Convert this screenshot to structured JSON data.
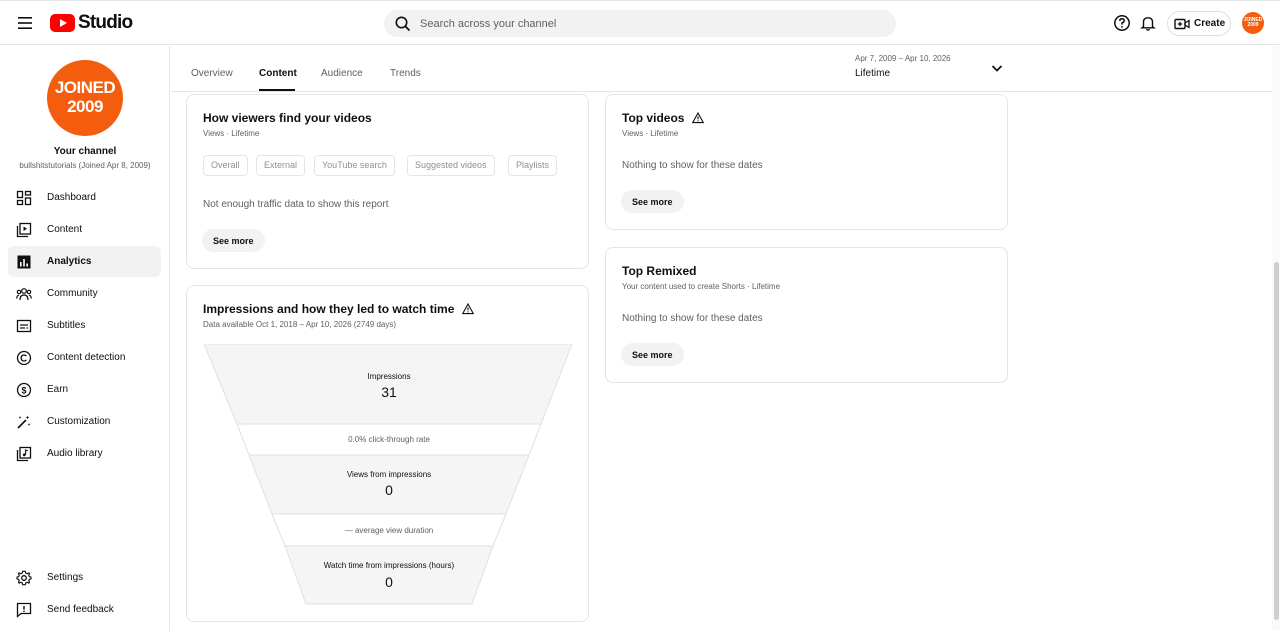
{
  "header": {
    "logo_text": "Studio",
    "search_placeholder": "Search across your channel",
    "create_label": "Create",
    "avatar_text": "JOINED 2009"
  },
  "sidebar": {
    "avatar_line1": "JOINED",
    "avatar_line2": "2009",
    "channel_title": "Your channel",
    "channel_sub": "bullshitstutorials (Joined Apr 8, 2009)",
    "items": [
      {
        "label": "Dashboard",
        "icon": "dashboard-icon"
      },
      {
        "label": "Content",
        "icon": "content-icon"
      },
      {
        "label": "Analytics",
        "icon": "analytics-icon",
        "active": true
      },
      {
        "label": "Community",
        "icon": "community-icon"
      },
      {
        "label": "Subtitles",
        "icon": "subtitles-icon"
      },
      {
        "label": "Content detection",
        "icon": "copyright-icon"
      },
      {
        "label": "Earn",
        "icon": "dollar-icon"
      },
      {
        "label": "Customization",
        "icon": "magic-wand-icon"
      },
      {
        "label": "Audio library",
        "icon": "audio-library-icon"
      }
    ],
    "footer": [
      {
        "label": "Settings",
        "icon": "gear-icon"
      },
      {
        "label": "Send feedback",
        "icon": "feedback-icon"
      }
    ]
  },
  "tabs": {
    "items": [
      "Overview",
      "Content",
      "Audience",
      "Trends"
    ],
    "active": "Content"
  },
  "date_range": {
    "range": "Apr 7, 2009 – Apr 10, 2026",
    "value": "Lifetime"
  },
  "traffic_card": {
    "title": "How viewers find your videos",
    "subtitle": "Views · Lifetime",
    "chips": [
      "Overall",
      "External",
      "YouTube search",
      "Suggested videos",
      "Playlists"
    ],
    "message": "Not enough traffic data to show this report",
    "button": "See more"
  },
  "impressions_card": {
    "title": "Impressions and how they led to watch time",
    "subtitle": "Data available Oct 1, 2018 – Apr 10, 2026 (2749 days)",
    "impressions_label": "Impressions",
    "impressions_value": "31",
    "ctr": "0.0% click-through rate",
    "views_label": "Views from impressions",
    "views_value": "0",
    "avd": "— average view duration",
    "watch_label": "Watch time from impressions (hours)",
    "watch_value": "0"
  },
  "top_videos_card": {
    "title": "Top videos",
    "subtitle": "Views · Lifetime",
    "message": "Nothing to show for these dates",
    "button": "See more"
  },
  "top_remixed_card": {
    "title": "Top Remixed",
    "subtitle": "Your content used to create Shorts · Lifetime",
    "message": "Nothing to show for these dates",
    "button": "See more"
  },
  "colors": {
    "brand_red": "#ff0000",
    "avatar_orange": "#f45d0e",
    "funnel_fill": "#f5f5f5"
  }
}
